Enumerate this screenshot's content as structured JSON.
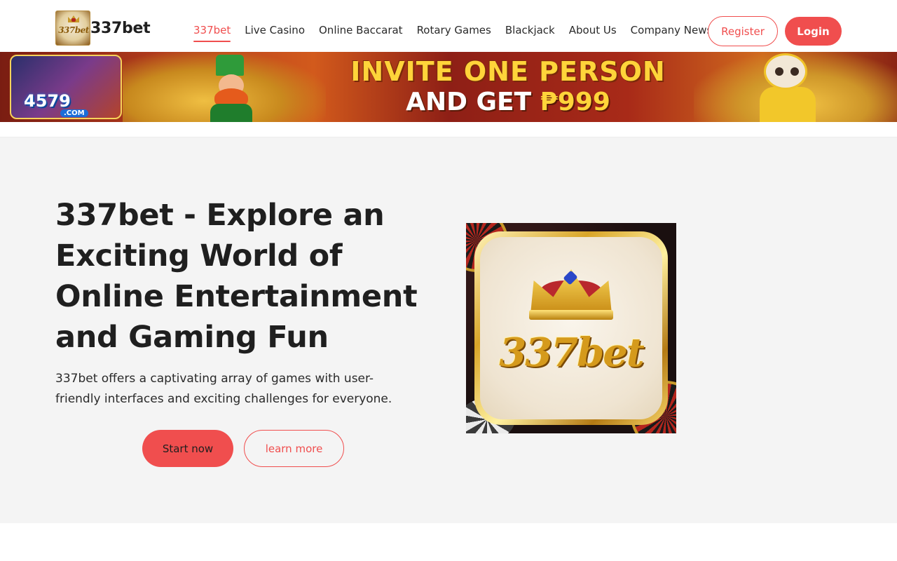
{
  "header": {
    "brand_name": "337bet",
    "brand_logo_text": "337bet",
    "nav": [
      {
        "label": "337bet",
        "active": true
      },
      {
        "label": "Live Casino",
        "active": false
      },
      {
        "label": "Online Baccarat",
        "active": false
      },
      {
        "label": "Rotary Games",
        "active": false
      },
      {
        "label": "Blackjack",
        "active": false
      },
      {
        "label": "About Us",
        "active": false
      },
      {
        "label": "Company News",
        "active": false
      }
    ],
    "register_label": "Register",
    "login_label": "Login"
  },
  "banner": {
    "site_badge": "4579",
    "site_badge_suffix": ".COM",
    "line1": "INVITE ONE PERSON",
    "line2_prefix": "AND GET ",
    "line2_amount": "₱999"
  },
  "hero": {
    "title": "337bet - Explore an Exciting World of Online Entertainment and Gaming Fun",
    "description": "337bet offers a captivating array of games with user-friendly interfaces and exciting challenges for everyone.",
    "start_label": "Start now",
    "learn_label": "learn more",
    "image_logo_text": "337bet"
  },
  "colors": {
    "accent": "#f04e4e",
    "hero_bg": "#f4f4f4",
    "text": "#1f1f1f"
  }
}
